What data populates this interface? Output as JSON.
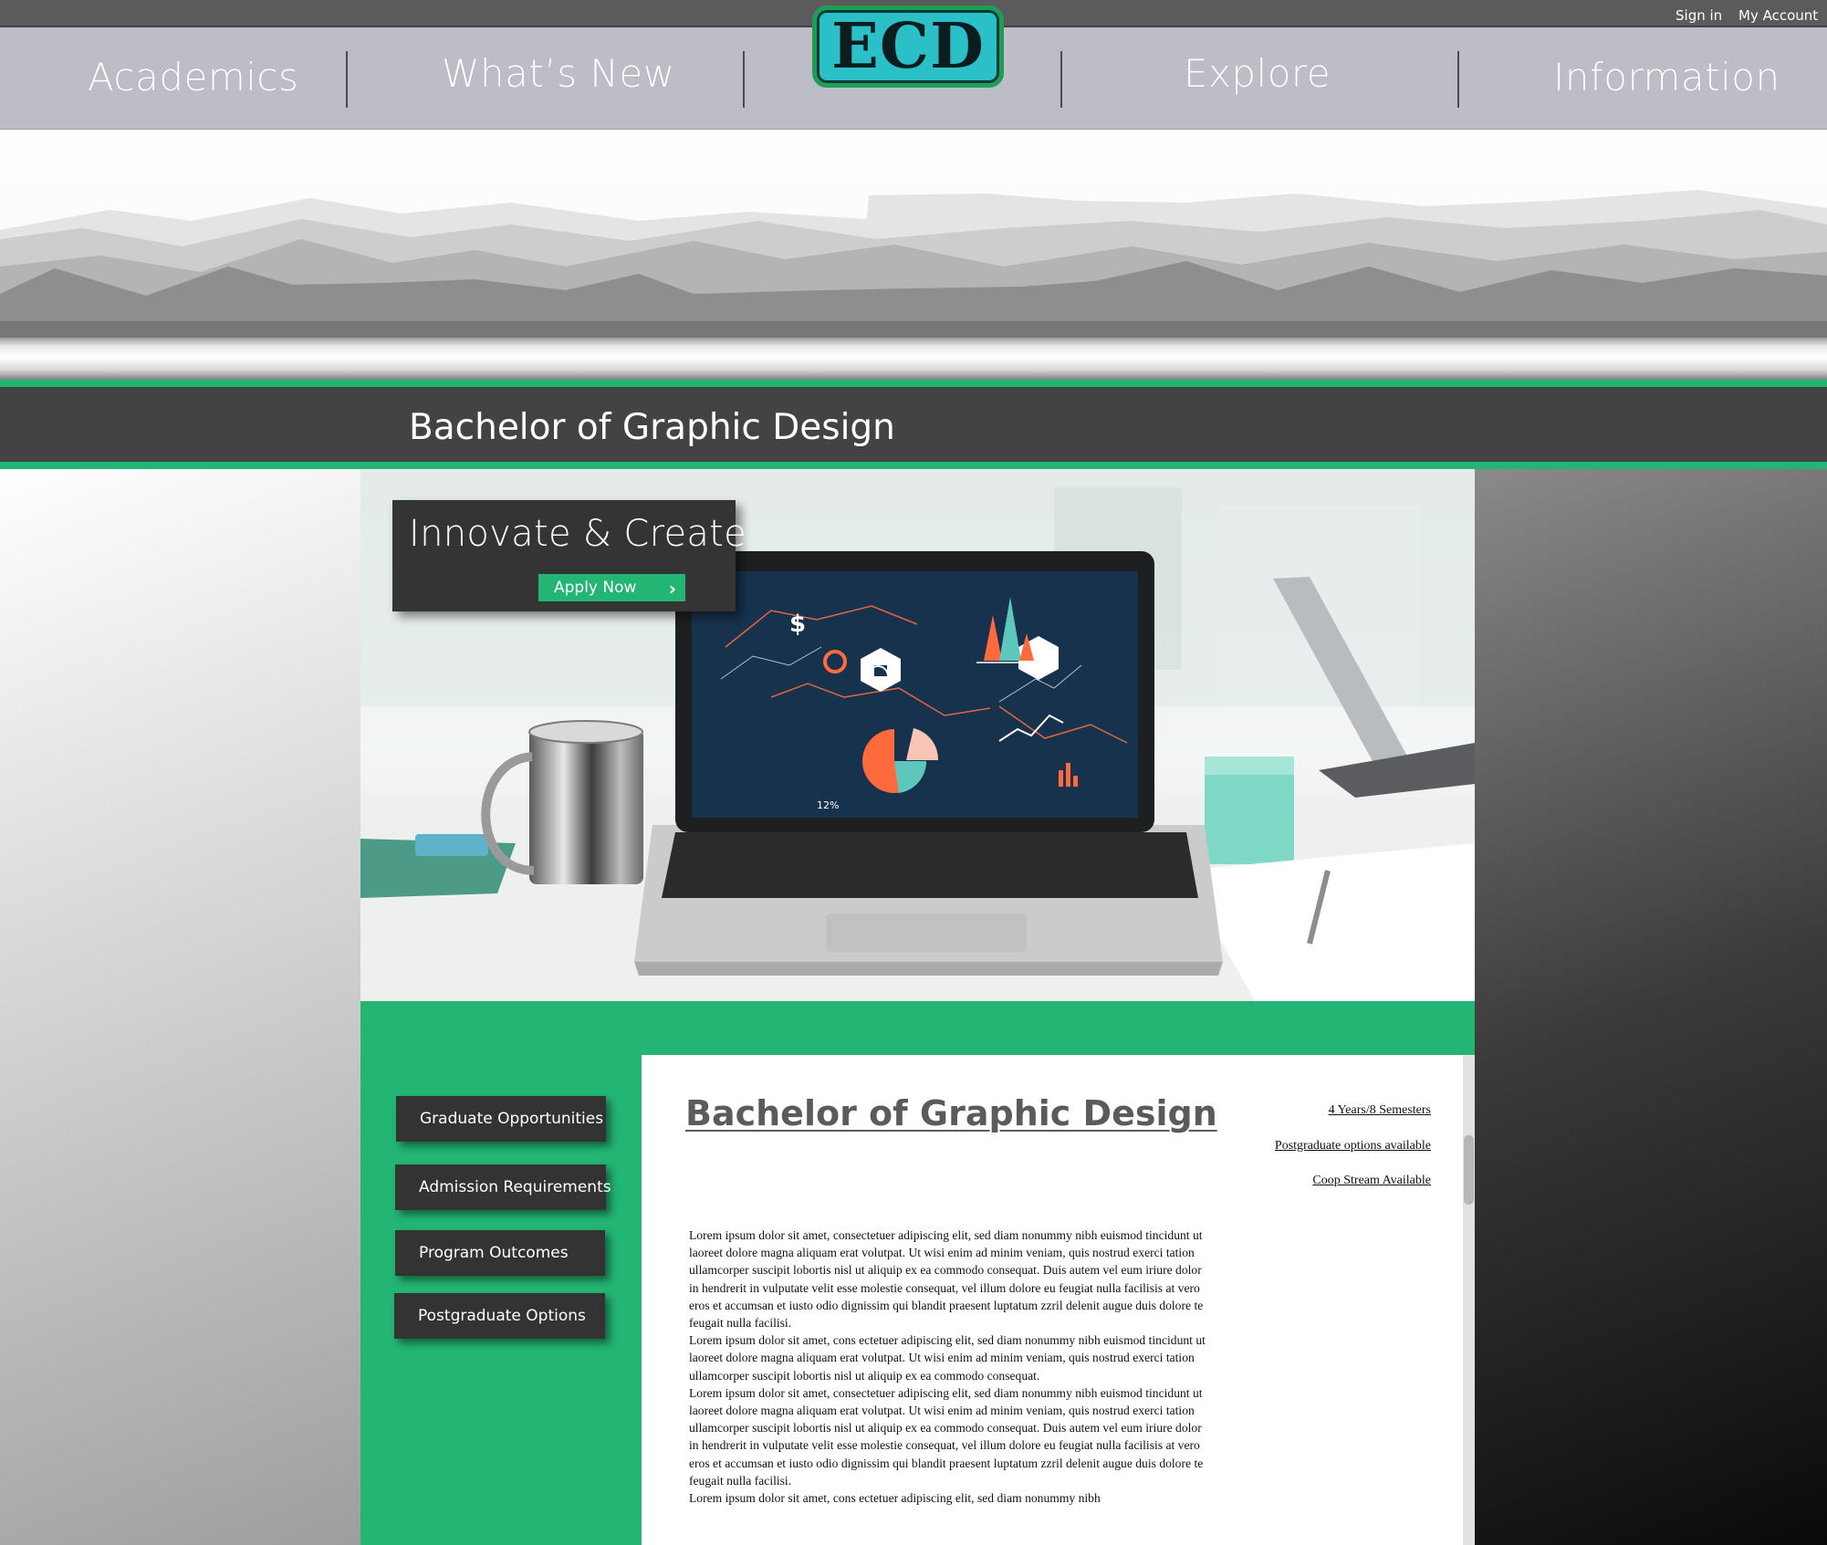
{
  "topbar": {
    "sign_in": "Sign in",
    "my_account": "My Account"
  },
  "nav": {
    "items": [
      "Academics",
      "What’s New",
      "Explore",
      "Information"
    ],
    "logo_text": "ECD"
  },
  "page_title": "Bachelor of Graphic Design",
  "hero": {
    "headline": "Innovate & Create",
    "cta_label": "Apply Now",
    "cta_icon": "chevron-right-icon",
    "screen_label": "12%"
  },
  "sidebar_buttons": [
    "Graduate Opportunities",
    "Admission Requirements",
    "Program Outcomes",
    "Postgraduate Options"
  ],
  "content": {
    "title": "Bachelor of Graphic Design",
    "meta": [
      "4 Years/8 Semesters",
      "Postgraduate options available",
      "Coop Stream Available"
    ],
    "paragraphs": [
      "Lorem ipsum dolor sit amet, consectetuer adipiscing elit, sed diam nonummy nibh euismod tincidunt ut laoreet dolore magna aliquam erat volutpat. Ut wisi enim ad minim veniam, quis nostrud exerci tation ullamcorper suscipit lobortis nisl ut aliquip ex ea commodo consequat. Duis autem vel eum iriure dolor in hendrerit in vulputate velit esse molestie consequat, vel illum dolore eu feugiat nulla facilisis at vero eros et accumsan et iusto odio dignissim qui blandit praesent luptatum zzril delenit augue duis dolore te feugait nulla facilisi.",
      "Lorem ipsum dolor sit amet, cons ectetuer adipiscing elit, sed diam nonummy nibh euismod tincidunt ut laoreet dolore magna aliquam erat volutpat. Ut wisi enim ad minim veniam, quis nostrud exerci tation ullamcorper suscipit lobortis nisl ut aliquip ex ea commodo consequat.",
      "Lorem ipsum dolor sit amet, consectetuer adipiscing elit, sed diam nonummy nibh euismod tincidunt ut laoreet dolore magna aliquam erat volutpat. Ut wisi enim ad minim veniam, quis nostrud exerci tation ullamcorper suscipit lobortis nisl ut aliquip ex ea commodo consequat. Duis autem vel eum iriure dolor in hendrerit in vulputate velit esse molestie consequat, vel illum dolore eu feugiat nulla facilisis at vero eros et accumsan et iusto odio dignissim qui blandit praesent luptatum zzril delenit augue duis dolore te feugait nulla facilisi.",
      "Lorem ipsum dolor sit amet, cons ectetuer adipiscing elit, sed diam nonummy nibh"
    ]
  },
  "colors": {
    "accent": "#22b573",
    "nav_bg": "#bdbdc8",
    "dark": "#343434",
    "logo_fill": "#2bc0c8"
  }
}
